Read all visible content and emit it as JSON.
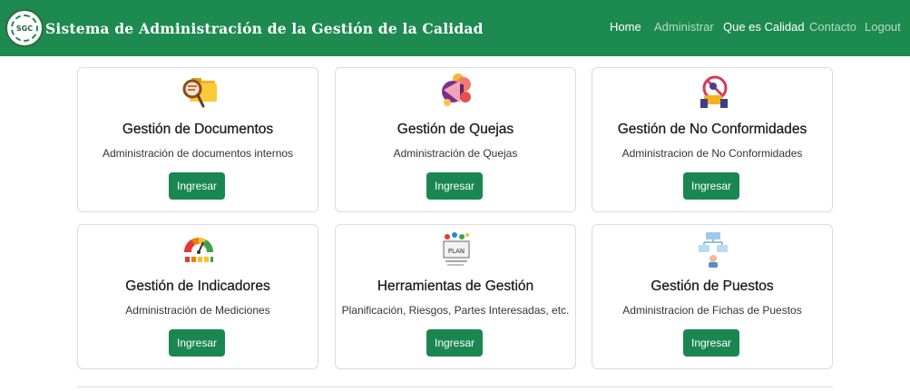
{
  "brand": {
    "logo_text": "SGC",
    "title": "Sistema de Administración de la Gestión de la Calidad"
  },
  "nav": {
    "home": "Home",
    "administrar": "Administrar",
    "que_es_calidad": "Que es Calidad",
    "contacto": "Contacto",
    "logout": "Logout"
  },
  "cards": [
    {
      "title": "Gestión de Documentos",
      "text": "Administración de documentos internos",
      "button": "Ingresar",
      "icon": "folder-magnifier-icon"
    },
    {
      "title": "Gestión de Quejas",
      "text": "Administración de Quejas",
      "button": "Ingresar",
      "icon": "megaphone-icon"
    },
    {
      "title": "Gestión de No Conformidades",
      "text": "Administracion de No Conformidades",
      "button": "Ingresar",
      "icon": "prohibited-icon"
    },
    {
      "title": "Gestión de Indicadores",
      "text": "Administración de Mediciones",
      "button": "Ingresar",
      "icon": "gauge-icon"
    },
    {
      "title": "Herramientas de Gestión",
      "text": "Planificación, Riesgos, Partes Interesadas, etc.",
      "button": "Ingresar",
      "icon": "plan-board-icon"
    },
    {
      "title": "Gestión de Puestos",
      "text": "Administracion de Fichas de Puestos",
      "button": "Ingresar",
      "icon": "org-chart-icon"
    }
  ],
  "colors": {
    "navbar": "#1d8a4f",
    "button": "#1a8750"
  }
}
